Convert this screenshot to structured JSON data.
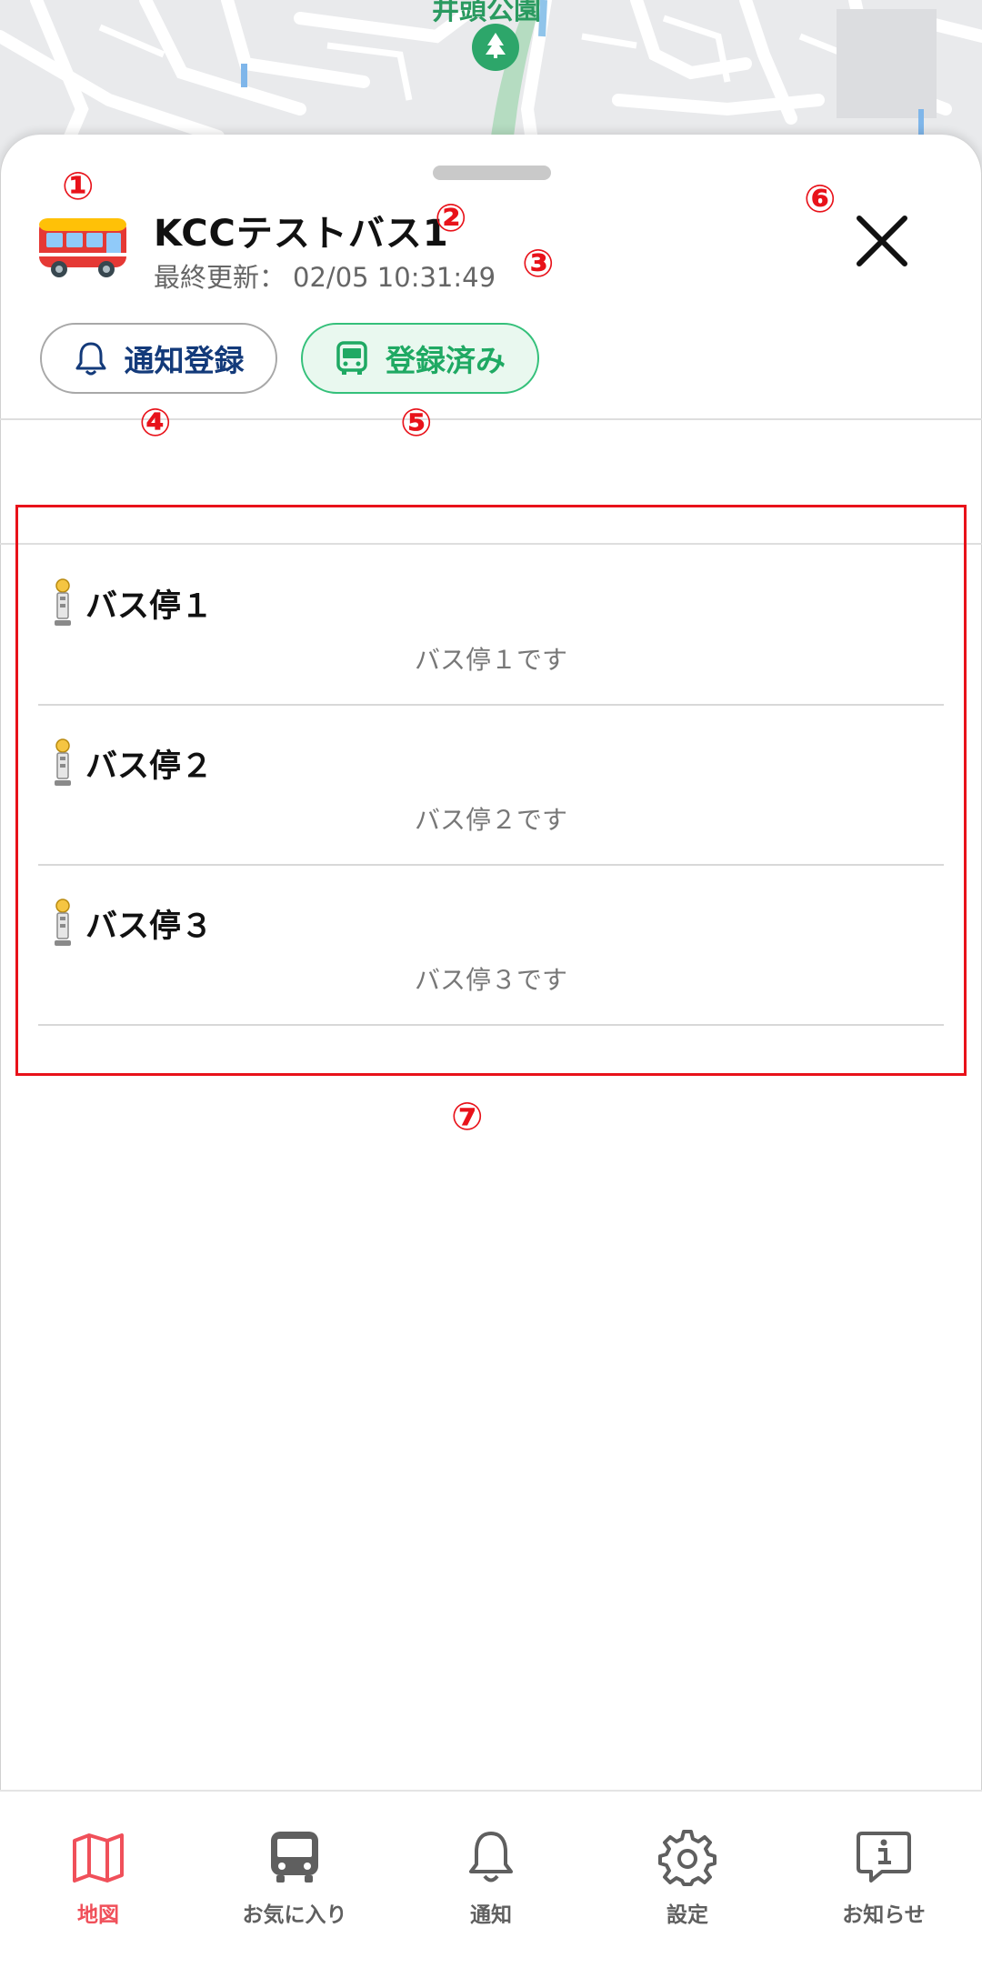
{
  "map": {
    "park_label": "井頭公園"
  },
  "sheet": {
    "title": "KCCテストバス1",
    "updated_label": "最終更新：",
    "updated_value": "02/05 10:31:49",
    "notify_button": "通知登録",
    "registered_button": "登録済み"
  },
  "stops": [
    {
      "name": "バス停１",
      "description": "バス停１です"
    },
    {
      "name": "バス停２",
      "description": "バス停２です"
    },
    {
      "name": "バス停３",
      "description": "バス停３です"
    }
  ],
  "annotations": {
    "n1": "①",
    "n2": "②",
    "n3": "③",
    "n4": "④",
    "n5": "⑤",
    "n6": "⑥",
    "n7": "⑦"
  },
  "nav": {
    "items": [
      {
        "label": "地図",
        "icon": "map-icon",
        "active": true
      },
      {
        "label": "お気に入り",
        "icon": "bus-icon"
      },
      {
        "label": "通知",
        "icon": "bell-icon"
      },
      {
        "label": "設定",
        "icon": "gear-icon"
      },
      {
        "label": "お知らせ",
        "icon": "info-bubble-icon"
      }
    ]
  },
  "colors": {
    "accent_red": "#f0505a",
    "annotation_red": "#e8121a",
    "registered_green": "#1fa963",
    "notify_navy": "#133a7a"
  }
}
